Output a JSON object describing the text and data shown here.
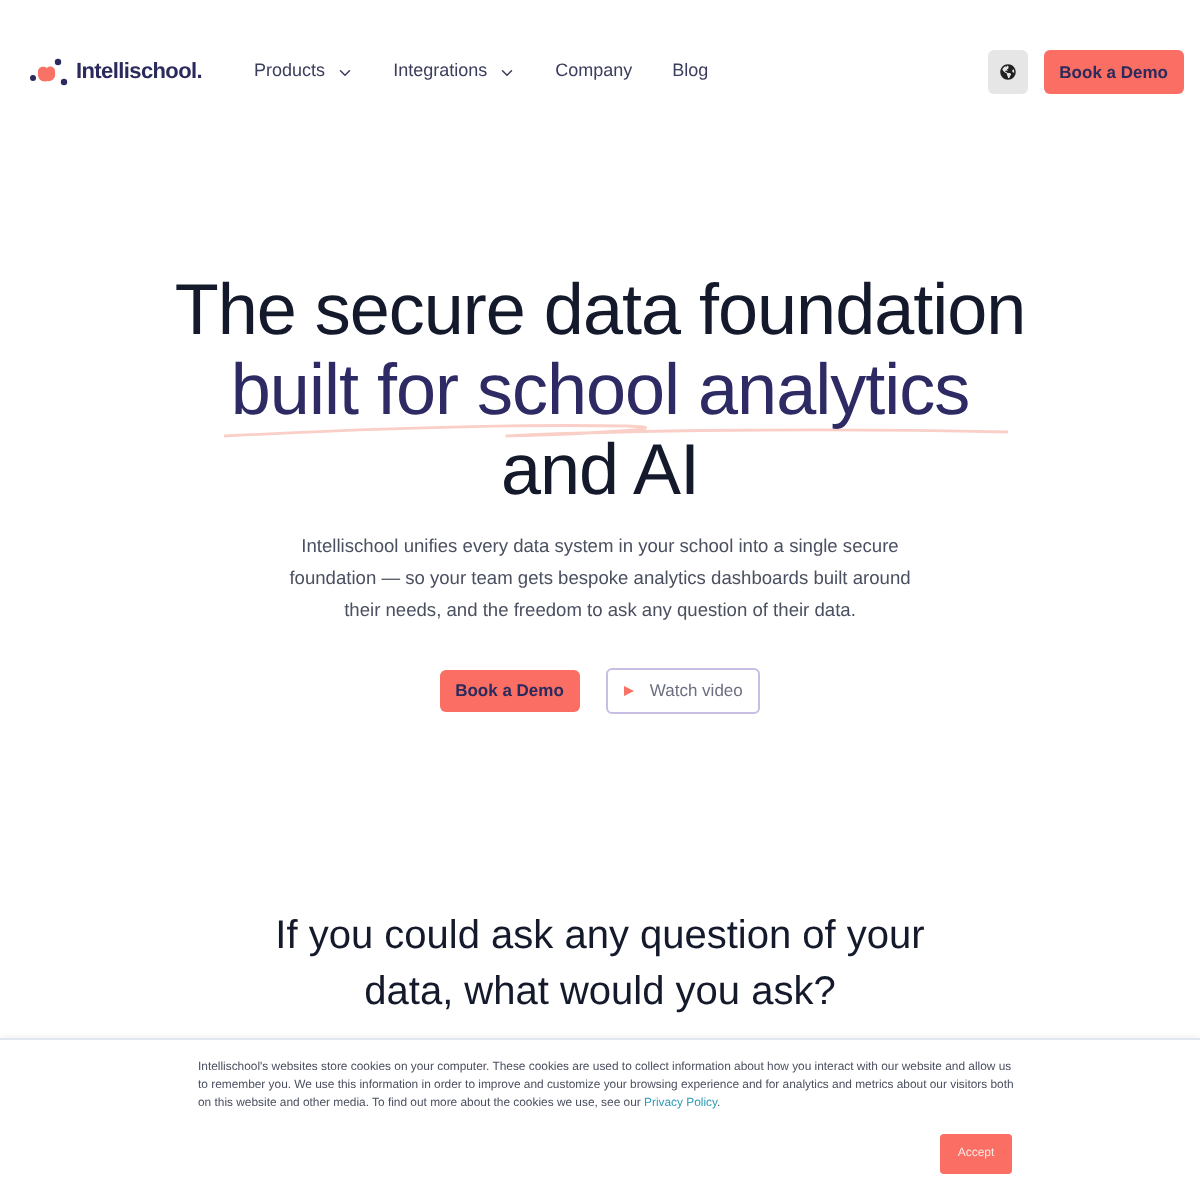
{
  "nav": {
    "logo": "Intellischool.",
    "items": [
      {
        "label": "Products",
        "dropdown": true
      },
      {
        "label": "Integrations",
        "dropdown": true
      },
      {
        "label": "Company",
        "dropdown": false
      },
      {
        "label": "Blog",
        "dropdown": false
      }
    ],
    "cta": "Book a Demo"
  },
  "hero": {
    "title_lines": [
      {
        "text": "The secure data foundation",
        "highlighted": false
      },
      {
        "text": "built for school analytics",
        "highlighted": true
      },
      {
        "text": "and AI",
        "highlighted": false
      }
    ],
    "description": "Intellischool unifies every data system in your school into a single secure foundation — so your team gets bespoke analytics dashboards built around their needs, and the freedom to ask any question of their data.",
    "buttons": [
      {
        "kind": "primary",
        "label": "Book a Demo"
      },
      {
        "kind": "video",
        "label": "Watch video"
      }
    ]
  },
  "section": {
    "heading": "If you could ask any question of your data, what would you ask?"
  },
  "cookie_banner": {
    "text": "Intellischool's websites store cookies on your computer. These cookies are used to collect information about how you interact with our website and allow us to remember you. We use this information in order to improve and customize your browsing experience and for analytics and metrics about our visitors both on this website and other media. To find out more about the cookies we use, see our",
    "link": "Privacy Policy",
    "suffix": ".",
    "button": "Accept"
  }
}
